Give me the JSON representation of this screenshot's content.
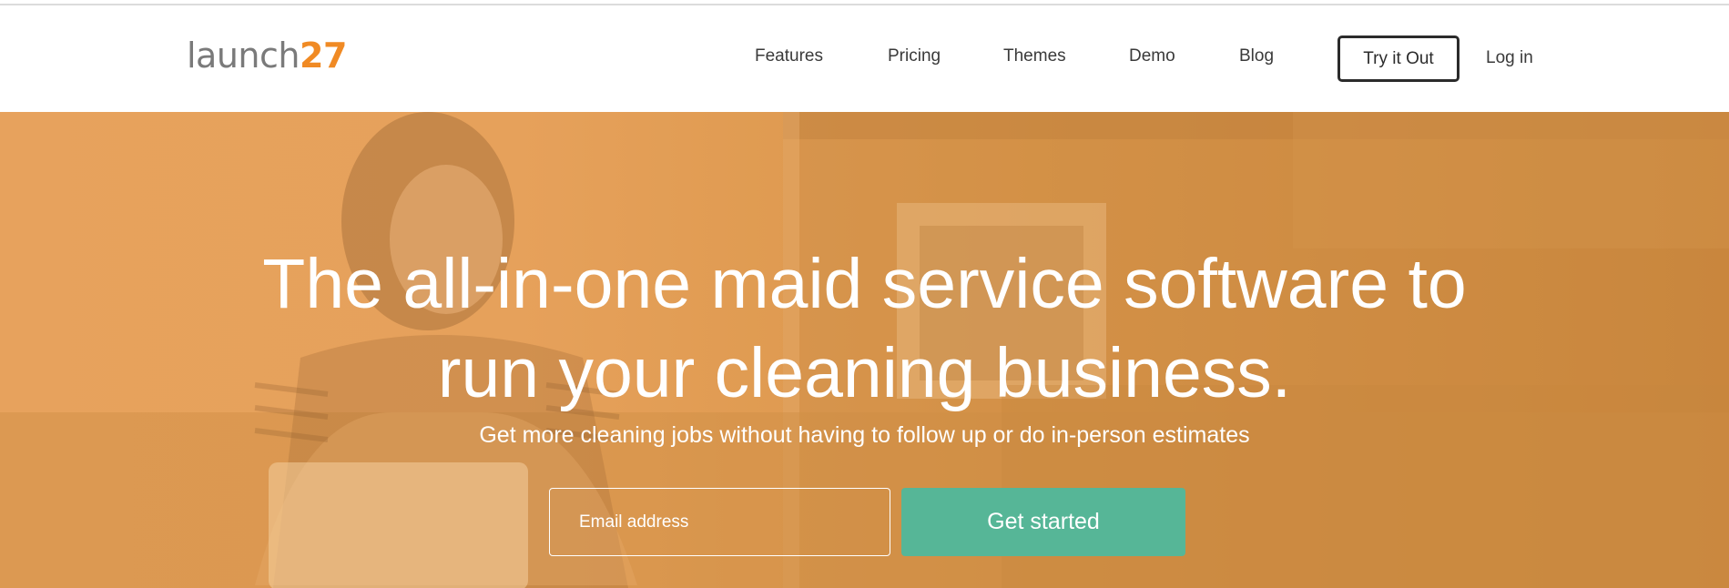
{
  "header": {
    "logo_word": "launch",
    "logo_number": "27",
    "nav": [
      {
        "label": "Features"
      },
      {
        "label": "Pricing"
      },
      {
        "label": "Themes"
      },
      {
        "label": "Demo"
      },
      {
        "label": "Blog"
      }
    ],
    "try_label": "Try it Out",
    "login_label": "Log in"
  },
  "hero": {
    "headline_line1": "The all-in-one maid service software to",
    "headline_line2": "run your cleaning business.",
    "subheadline": "Get more cleaning jobs without having to follow up or do in-person estimates",
    "email_placeholder": "Email address",
    "cta_label": "Get started"
  },
  "colors": {
    "brand_orange": "#f08a24",
    "hero_overlay": "#e6a15b",
    "cta_green": "#56b697",
    "nav_text": "#3a3a3a"
  }
}
